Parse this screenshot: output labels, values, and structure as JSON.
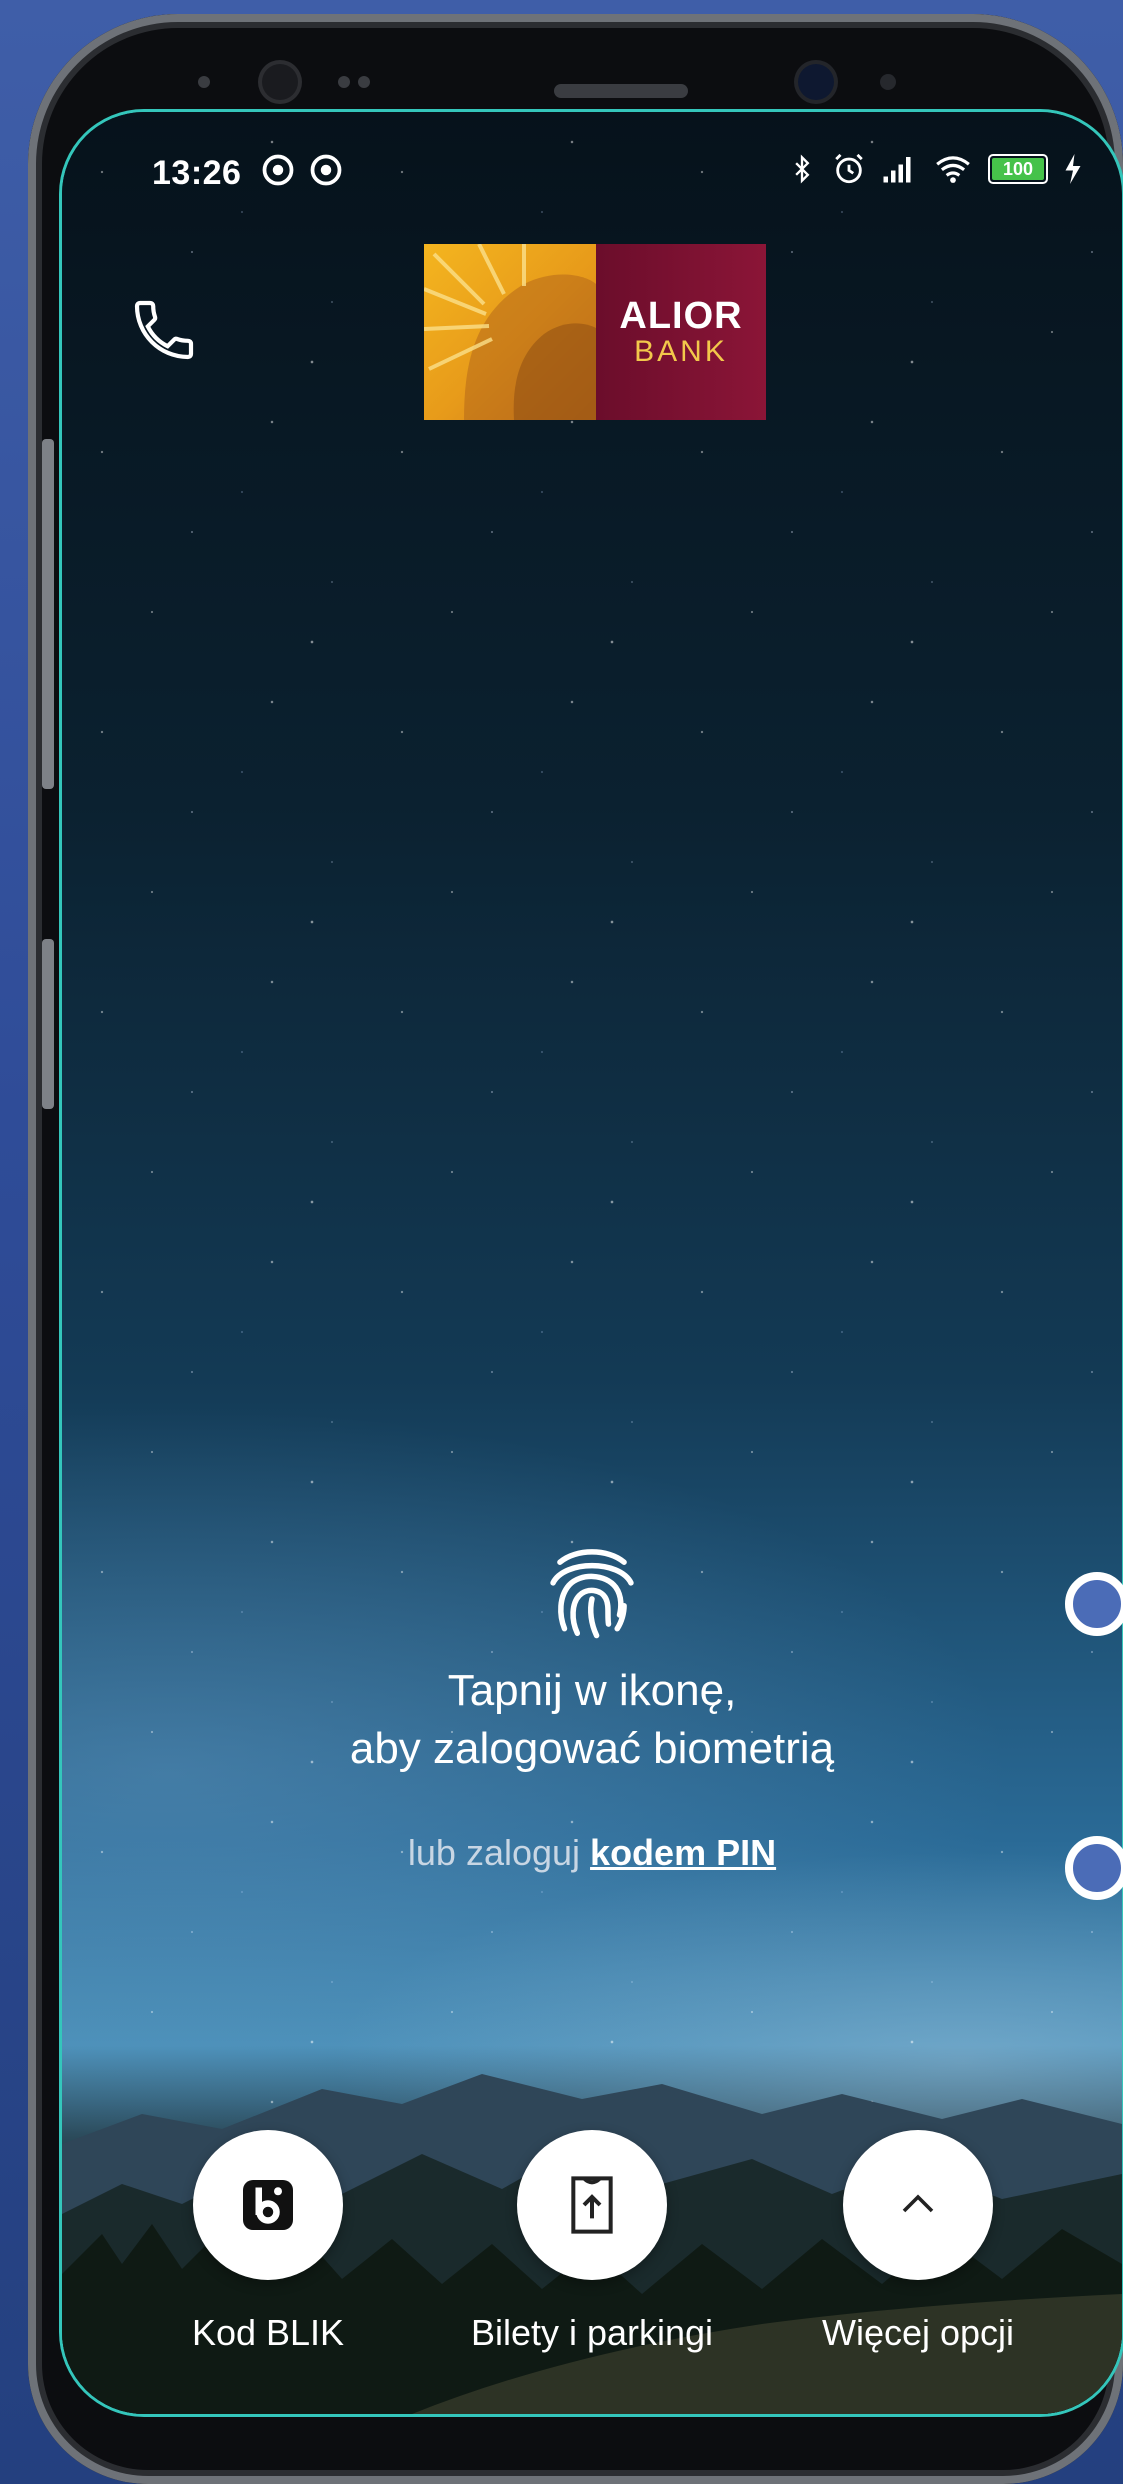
{
  "status_bar": {
    "time": "13:26",
    "battery": "100"
  },
  "header": {
    "call_icon": "phone-icon",
    "logo": {
      "name": "ALIOR",
      "sub": "BANK"
    }
  },
  "login": {
    "biometric_icon": "fingerprint-icon",
    "line1": "Tapnij w ikonę,",
    "line2": "aby zalogować biometrią",
    "alt_prefix": "lub zaloguj",
    "alt_link": "kodem PIN"
  },
  "actions": [
    {
      "label": "Kod BLIK",
      "icon": "blik-icon"
    },
    {
      "label": "Bilety i parkingi",
      "icon": "ticket-icon"
    },
    {
      "label": "Więcej opcji",
      "icon": "chevron-up-icon"
    }
  ],
  "colors": {
    "accent_border": "#34c6bb",
    "logo_gold": "#f4b51f",
    "logo_maroon": "#6b0d2b",
    "page_bg": "#3f5ea8"
  }
}
